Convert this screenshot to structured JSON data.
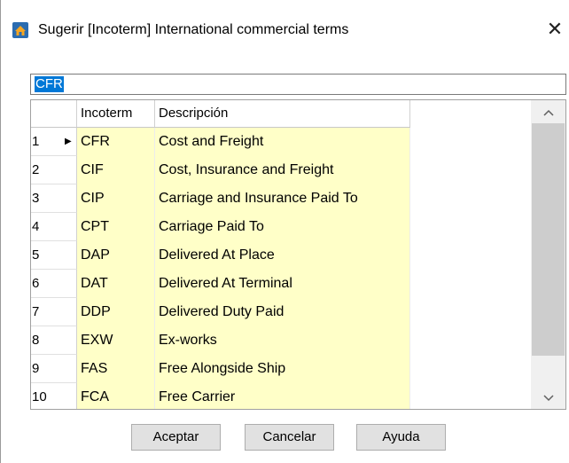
{
  "window": {
    "title": "Sugerir [Incoterm] International commercial terms",
    "icon": "app-home-icon",
    "close_glyph": "✕"
  },
  "search": {
    "value": "CFR"
  },
  "grid": {
    "columns": [
      "Incoterm",
      "Descripción"
    ],
    "current_row_marker": "▶",
    "rows": [
      {
        "num": "1",
        "code": "CFR",
        "desc": "Cost and Freight"
      },
      {
        "num": "2",
        "code": "CIF",
        "desc": "Cost, Insurance and Freight"
      },
      {
        "num": "3",
        "code": "CIP",
        "desc": "Carriage and Insurance Paid To"
      },
      {
        "num": "4",
        "code": "CPT",
        "desc": "Carriage Paid To"
      },
      {
        "num": "5",
        "code": "DAP",
        "desc": "Delivered At Place"
      },
      {
        "num": "6",
        "code": "DAT",
        "desc": "Delivered At Terminal"
      },
      {
        "num": "7",
        "code": "DDP",
        "desc": "Delivered Duty Paid"
      },
      {
        "num": "8",
        "code": "EXW",
        "desc": "Ex-works"
      },
      {
        "num": "9",
        "code": "FAS",
        "desc": "Free Alongside Ship"
      },
      {
        "num": "10",
        "code": "FCA",
        "desc": "Free Carrier"
      }
    ],
    "scroll": {
      "up_glyph": "^",
      "down_glyph": "v"
    }
  },
  "buttons": {
    "accept": "Aceptar",
    "cancel": "Cancelar",
    "help": "Ayuda"
  },
  "colors": {
    "row_highlight": "#ffffc8",
    "selection": "#0078d7"
  }
}
